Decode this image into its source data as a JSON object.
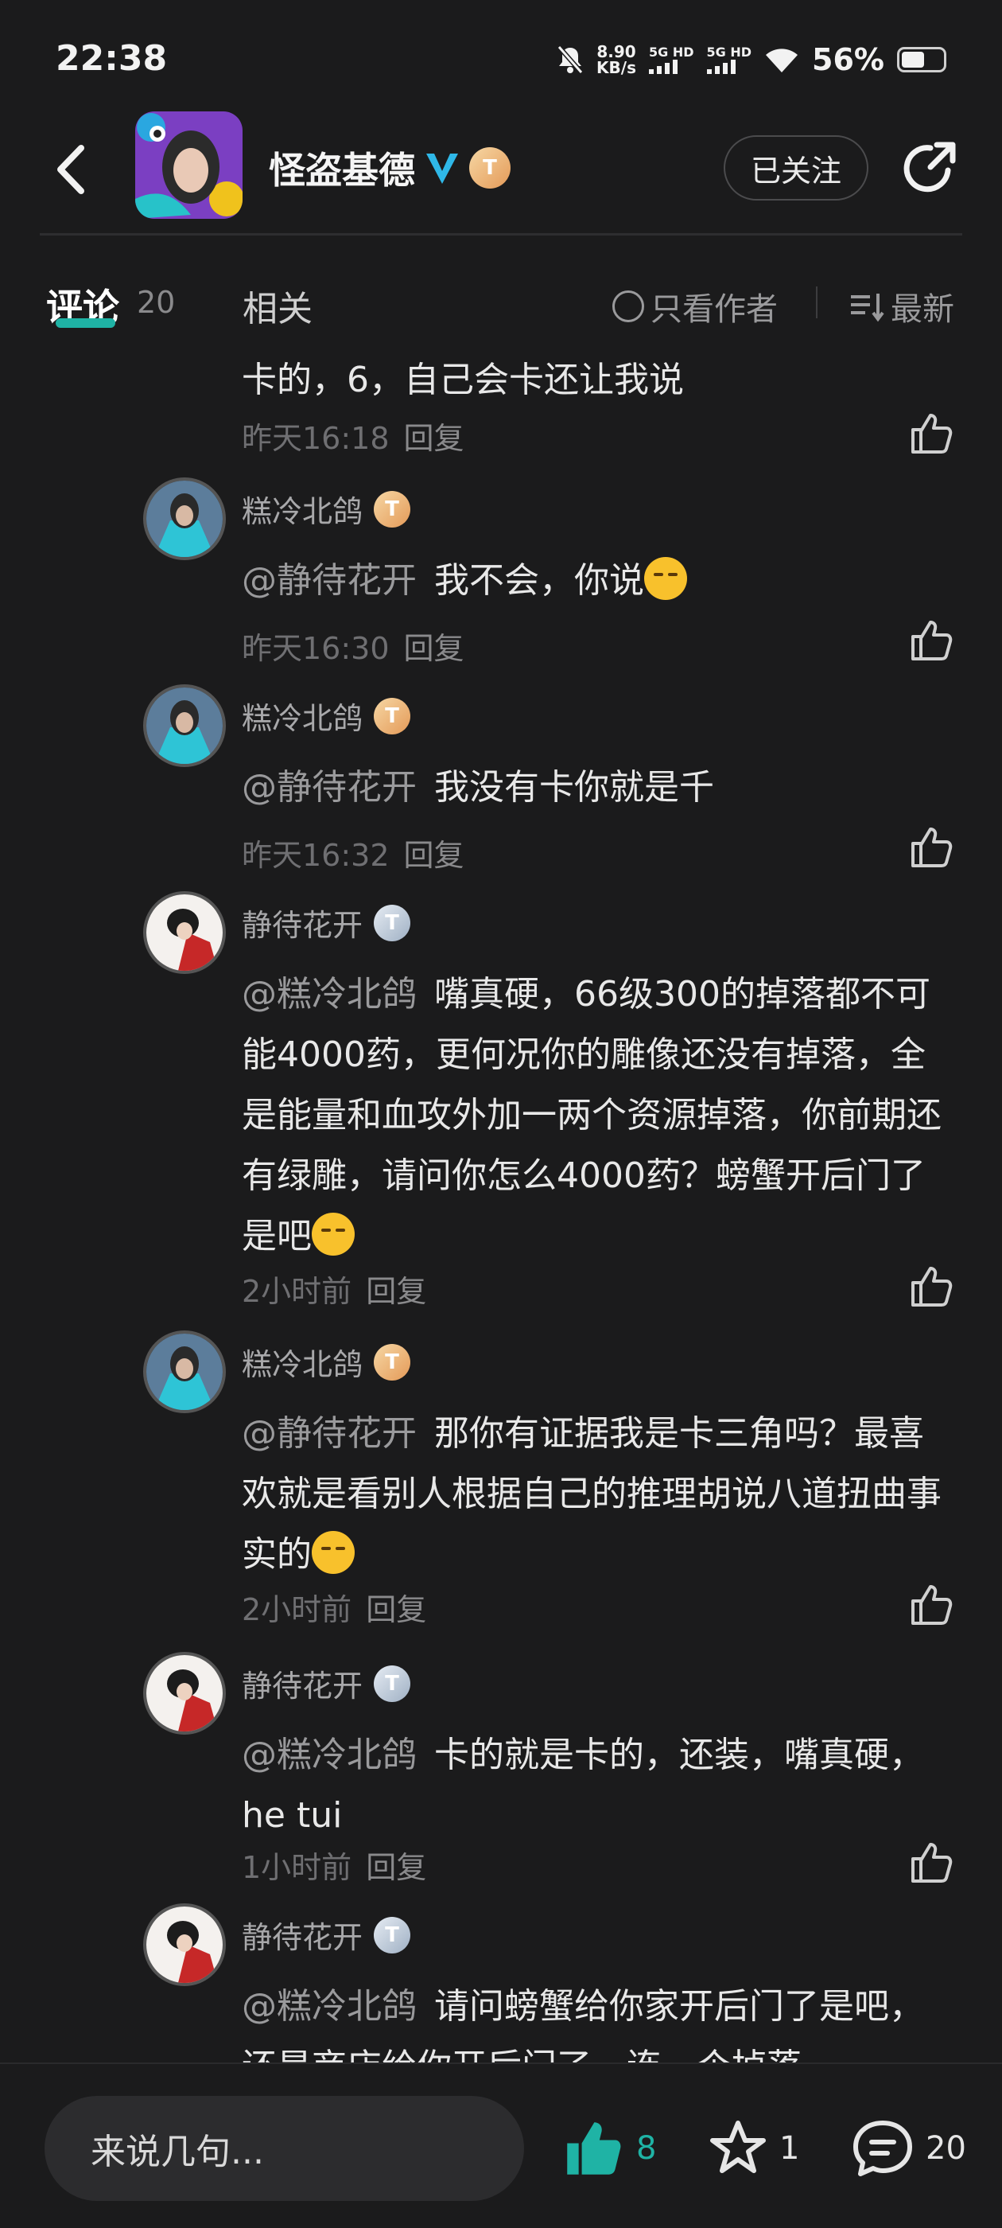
{
  "status_bar": {
    "time": "22:38",
    "net_speed_value": "8.90",
    "net_speed_unit": "KB/s",
    "sim1": "5G HD",
    "sim2": "5G HD",
    "battery": "56%"
  },
  "header": {
    "author_name": "怪盗基德",
    "follow_label": "已关注"
  },
  "tabs": {
    "comments_label": "评论",
    "comments_count": "20",
    "related_label": "相关",
    "only_author_label": "只看作者",
    "sort_label": "最新"
  },
  "comments": [
    {
      "text": "卡的，6，自己会卡还让我说",
      "time": "昨天16:18",
      "reply": "回复"
    },
    {
      "name": "糕冷北鸽",
      "badge": "gold",
      "mention": "@静待花开",
      "text": "我不会，你说",
      "emoji": true,
      "time": "昨天16:30",
      "reply": "回复"
    },
    {
      "name": "糕冷北鸽",
      "badge": "gold",
      "mention": "@静待花开",
      "text": "我没有卡你就是千",
      "time": "昨天16:32",
      "reply": "回复"
    },
    {
      "name": "静待花开",
      "badge": "silver",
      "mention": "@糕冷北鸽",
      "text": "嘴真硬，66级300的掉落都不可能4000药，更何况你的雕像还没有掉落，全是能量和血攻外加一两个资源掉落，你前期还有绿雕，请问你怎么4000药？螃蟹开后门了是吧",
      "emoji": true,
      "time": "2小时前",
      "reply": "回复"
    },
    {
      "name": "糕冷北鸽",
      "badge": "gold",
      "mention": "@静待花开",
      "text": "那你有证据我是卡三角吗？最喜欢就是看别人根据自己的推理胡说八道扭曲事实的",
      "emoji": true,
      "time": "2小时前",
      "reply": "回复"
    },
    {
      "name": "静待花开",
      "badge": "silver",
      "mention": "@糕冷北鸽",
      "text": "卡的就是卡的，还装，嘴真硬，he  tui",
      "time": "1小时前",
      "reply": "回复"
    },
    {
      "name": "静待花开",
      "badge": "silver",
      "mention": "@糕冷北鸽",
      "text": "请问螃蟹给你家开后门了是吧，还是商店给你开后门了，连一个掉落"
    }
  ],
  "bottom_bar": {
    "input_placeholder": "来说几句...",
    "like_count": "8",
    "fav_count": "1",
    "comment_count": "20"
  },
  "colors": {
    "background": "#1b1b1c",
    "accent": "#1fb3a5",
    "verified": "#2fb8e8"
  }
}
